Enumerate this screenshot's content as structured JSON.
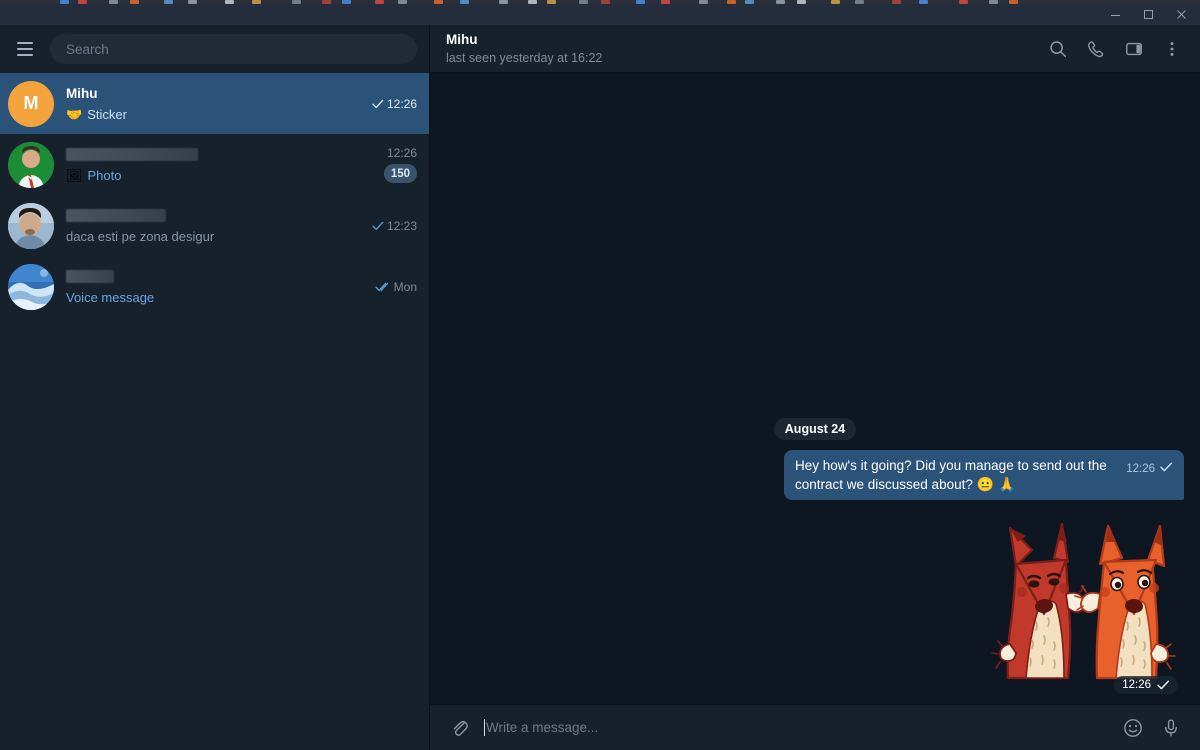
{
  "window": {
    "controls": [
      {
        "name": "minimize",
        "label": "–"
      },
      {
        "name": "maximize",
        "label": "▢"
      },
      {
        "name": "close",
        "label": "✕"
      }
    ]
  },
  "background_strip": {
    "tab_colors": [
      "#4a8fe0",
      "#d94a3d",
      "#8d9aa8",
      "#e06a2b",
      "#5a9bd8",
      "#9aa5b1",
      "#c7ccd3",
      "#d6a24a",
      "#7f8c99",
      "#b0453a"
    ]
  },
  "sidebar": {
    "menu_icon": "hamburger-icon",
    "search": {
      "placeholder": "Search",
      "value": ""
    },
    "chats": [
      {
        "name": "Mihu",
        "name_redacted": false,
        "avatar_type": "initials",
        "avatar_initials": "M",
        "avatar_color": "#f5a33c",
        "preview_icon": "sticker-icon",
        "preview_icon_glyph": "🤝",
        "preview_text": "Sticker",
        "preview_accent": false,
        "time": "12:26",
        "ticks": "single",
        "badge": "",
        "selected": true
      },
      {
        "name": "",
        "name_redacted": true,
        "redacted_width": 132,
        "avatar_type": "photo-person-green",
        "avatar_initials": "",
        "avatar_color": "#1e8a37",
        "preview_icon": "photo-icon",
        "preview_icon_glyph": "🖼",
        "preview_text": "Photo",
        "preview_accent": true,
        "time": "12:26",
        "ticks": "none",
        "badge": "150",
        "selected": false
      },
      {
        "name": "",
        "name_redacted": true,
        "redacted_width": 100,
        "avatar_type": "photo-person-snow",
        "avatar_initials": "",
        "avatar_color": "#7fa4c4",
        "preview_icon": "",
        "preview_icon_glyph": "",
        "preview_text": "daca esti pe zona desigur",
        "preview_accent": false,
        "time": "12:23",
        "ticks": "single",
        "badge": "",
        "selected": false
      },
      {
        "name": "",
        "name_redacted": true,
        "redacted_width": 48,
        "avatar_type": "photo-landscape",
        "avatar_initials": "",
        "avatar_color": "#4a90d9",
        "preview_icon": "",
        "preview_icon_glyph": "",
        "preview_text": "Voice message",
        "preview_accent": true,
        "time": "Mon",
        "ticks": "double",
        "badge": "",
        "selected": false
      }
    ]
  },
  "chat": {
    "title": "Mihu",
    "subtitle": "last seen yesterday at 16:22",
    "header_actions": [
      {
        "name": "search-icon",
        "label": "Search"
      },
      {
        "name": "phone-icon",
        "label": "Call"
      },
      {
        "name": "sidebar-panel-icon",
        "label": "Info"
      },
      {
        "name": "more-vertical-icon",
        "label": "More"
      }
    ],
    "date_divider": "August 24",
    "messages": [
      {
        "type": "text",
        "outgoing": true,
        "text": "Hey how's it going? Did you manage to send out the contract we discussed about?",
        "emojis": "😐 🙏",
        "time": "12:26",
        "ticks": "single"
      },
      {
        "type": "sticker",
        "outgoing": true,
        "sticker_name": "two-foxes-waving-sticker",
        "time": "12:26",
        "ticks": "single"
      }
    ]
  },
  "composer": {
    "attach_icon": "paperclip-icon",
    "placeholder": "Write a message...",
    "value": "",
    "emoji_icon": "smiley-icon",
    "mic_icon": "microphone-icon"
  },
  "colors": {
    "sidebar_bg": "#17212b",
    "chat_bg": "#0e1621",
    "selected_row": "#2b5278",
    "bubble_out": "#2b5278",
    "accent_text": "#6aa7e0",
    "title_bar": "#232d3b",
    "muted_text": "#7d8b9a"
  }
}
